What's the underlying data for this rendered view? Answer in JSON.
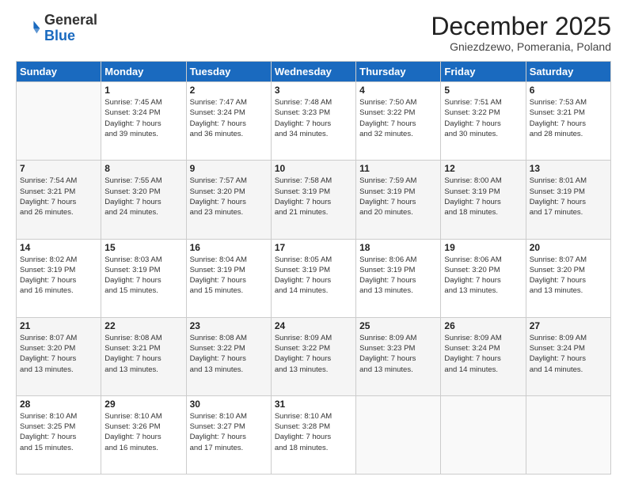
{
  "logo": {
    "general": "General",
    "blue": "Blue"
  },
  "header": {
    "month": "December 2025",
    "location": "Gniezdzewo, Pomerania, Poland"
  },
  "weekdays": [
    "Sunday",
    "Monday",
    "Tuesday",
    "Wednesday",
    "Thursday",
    "Friday",
    "Saturday"
  ],
  "weeks": [
    [
      {
        "day": "",
        "info": ""
      },
      {
        "day": "1",
        "info": "Sunrise: 7:45 AM\nSunset: 3:24 PM\nDaylight: 7 hours\nand 39 minutes."
      },
      {
        "day": "2",
        "info": "Sunrise: 7:47 AM\nSunset: 3:24 PM\nDaylight: 7 hours\nand 36 minutes."
      },
      {
        "day": "3",
        "info": "Sunrise: 7:48 AM\nSunset: 3:23 PM\nDaylight: 7 hours\nand 34 minutes."
      },
      {
        "day": "4",
        "info": "Sunrise: 7:50 AM\nSunset: 3:22 PM\nDaylight: 7 hours\nand 32 minutes."
      },
      {
        "day": "5",
        "info": "Sunrise: 7:51 AM\nSunset: 3:22 PM\nDaylight: 7 hours\nand 30 minutes."
      },
      {
        "day": "6",
        "info": "Sunrise: 7:53 AM\nSunset: 3:21 PM\nDaylight: 7 hours\nand 28 minutes."
      }
    ],
    [
      {
        "day": "7",
        "info": "Sunrise: 7:54 AM\nSunset: 3:21 PM\nDaylight: 7 hours\nand 26 minutes."
      },
      {
        "day": "8",
        "info": "Sunrise: 7:55 AM\nSunset: 3:20 PM\nDaylight: 7 hours\nand 24 minutes."
      },
      {
        "day": "9",
        "info": "Sunrise: 7:57 AM\nSunset: 3:20 PM\nDaylight: 7 hours\nand 23 minutes."
      },
      {
        "day": "10",
        "info": "Sunrise: 7:58 AM\nSunset: 3:19 PM\nDaylight: 7 hours\nand 21 minutes."
      },
      {
        "day": "11",
        "info": "Sunrise: 7:59 AM\nSunset: 3:19 PM\nDaylight: 7 hours\nand 20 minutes."
      },
      {
        "day": "12",
        "info": "Sunrise: 8:00 AM\nSunset: 3:19 PM\nDaylight: 7 hours\nand 18 minutes."
      },
      {
        "day": "13",
        "info": "Sunrise: 8:01 AM\nSunset: 3:19 PM\nDaylight: 7 hours\nand 17 minutes."
      }
    ],
    [
      {
        "day": "14",
        "info": "Sunrise: 8:02 AM\nSunset: 3:19 PM\nDaylight: 7 hours\nand 16 minutes."
      },
      {
        "day": "15",
        "info": "Sunrise: 8:03 AM\nSunset: 3:19 PM\nDaylight: 7 hours\nand 15 minutes."
      },
      {
        "day": "16",
        "info": "Sunrise: 8:04 AM\nSunset: 3:19 PM\nDaylight: 7 hours\nand 15 minutes."
      },
      {
        "day": "17",
        "info": "Sunrise: 8:05 AM\nSunset: 3:19 PM\nDaylight: 7 hours\nand 14 minutes."
      },
      {
        "day": "18",
        "info": "Sunrise: 8:06 AM\nSunset: 3:19 PM\nDaylight: 7 hours\nand 13 minutes."
      },
      {
        "day": "19",
        "info": "Sunrise: 8:06 AM\nSunset: 3:20 PM\nDaylight: 7 hours\nand 13 minutes."
      },
      {
        "day": "20",
        "info": "Sunrise: 8:07 AM\nSunset: 3:20 PM\nDaylight: 7 hours\nand 13 minutes."
      }
    ],
    [
      {
        "day": "21",
        "info": "Sunrise: 8:07 AM\nSunset: 3:20 PM\nDaylight: 7 hours\nand 13 minutes."
      },
      {
        "day": "22",
        "info": "Sunrise: 8:08 AM\nSunset: 3:21 PM\nDaylight: 7 hours\nand 13 minutes."
      },
      {
        "day": "23",
        "info": "Sunrise: 8:08 AM\nSunset: 3:22 PM\nDaylight: 7 hours\nand 13 minutes."
      },
      {
        "day": "24",
        "info": "Sunrise: 8:09 AM\nSunset: 3:22 PM\nDaylight: 7 hours\nand 13 minutes."
      },
      {
        "day": "25",
        "info": "Sunrise: 8:09 AM\nSunset: 3:23 PM\nDaylight: 7 hours\nand 13 minutes."
      },
      {
        "day": "26",
        "info": "Sunrise: 8:09 AM\nSunset: 3:24 PM\nDaylight: 7 hours\nand 14 minutes."
      },
      {
        "day": "27",
        "info": "Sunrise: 8:09 AM\nSunset: 3:24 PM\nDaylight: 7 hours\nand 14 minutes."
      }
    ],
    [
      {
        "day": "28",
        "info": "Sunrise: 8:10 AM\nSunset: 3:25 PM\nDaylight: 7 hours\nand 15 minutes."
      },
      {
        "day": "29",
        "info": "Sunrise: 8:10 AM\nSunset: 3:26 PM\nDaylight: 7 hours\nand 16 minutes."
      },
      {
        "day": "30",
        "info": "Sunrise: 8:10 AM\nSunset: 3:27 PM\nDaylight: 7 hours\nand 17 minutes."
      },
      {
        "day": "31",
        "info": "Sunrise: 8:10 AM\nSunset: 3:28 PM\nDaylight: 7 hours\nand 18 minutes."
      },
      {
        "day": "",
        "info": ""
      },
      {
        "day": "",
        "info": ""
      },
      {
        "day": "",
        "info": ""
      }
    ]
  ]
}
